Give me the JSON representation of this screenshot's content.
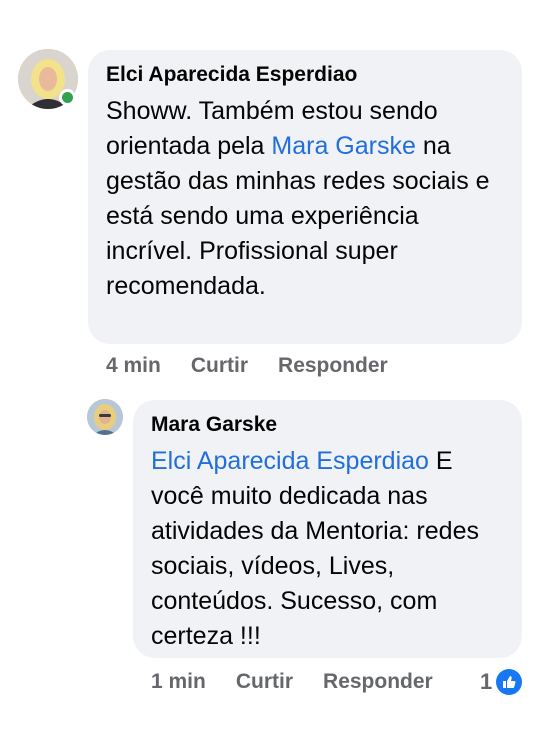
{
  "comment": {
    "author": "Elci Aparecida Esperdiao",
    "text_before": "Showw. Também estou sendo orientada pela ",
    "mention": "Mara Garske",
    "text_after": " na gestão das minhas redes sociais e está sendo uma experiência incrível. Profissional super recomendada.",
    "time": "4 min",
    "like_label": "Curtir",
    "reply_label": "Responder"
  },
  "reply": {
    "author": "Mara Garske",
    "mention": "Elci Aparecida Esperdiao",
    "text_after": " E você muito dedicada nas atividades da Mentoria: redes sociais, vídeos, Lives, conteúdos. Sucesso, com certeza !!!",
    "time": "1 min",
    "like_label": "Curtir",
    "reply_label": "Responder",
    "reaction_count": "1"
  },
  "colors": {
    "bubble": "#f0f2f5",
    "mention": "#216fdb",
    "meta": "#65676b",
    "online": "#31a24c",
    "like": "#1877f2"
  }
}
